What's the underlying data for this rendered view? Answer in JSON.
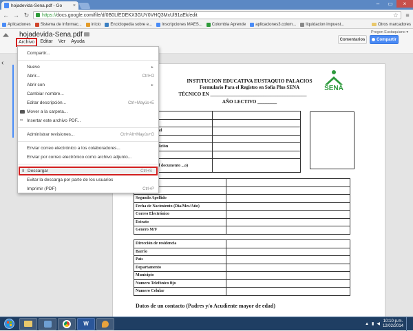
{
  "browser": {
    "tab_title": "hojadevida-Sena.pdf - Go",
    "url_scheme": "https://",
    "url_rest": "docs.google.com/file/d/0B0LfEDEKX3GUY0VHQ3MxUl91aEk/edit",
    "bookmarks": [
      {
        "label": "Aplicaciones",
        "color": "#4a8cf7"
      },
      {
        "label": "Sistema de Informac...",
        "color": "#d0452b"
      },
      {
        "label": "inicio",
        "color": "#e39b29"
      },
      {
        "label": "Enciclopedia sobre e...",
        "color": "#3a7fc2"
      },
      {
        "label": "Inscripciones MAES...",
        "color": "#4a8cf7"
      },
      {
        "label": "Colombia Aprende",
        "color": "#2d9a39"
      },
      {
        "label": "aplicaciones3.colom...",
        "color": "#4a8cf7"
      },
      {
        "label": "liquidacion impuest...",
        "color": "#888888"
      }
    ],
    "other_bookmarks": "Otros marcadores"
  },
  "viewer": {
    "doc_title": "hojadevida-Sena.pdf",
    "menu": {
      "archivo": "Archivo",
      "editar": "Editar",
      "ver": "Ver",
      "ayuda": "Ayuda"
    },
    "user": "Pregon Eustaquiano",
    "comments_btn": "Comentarios",
    "share_btn": "Compartir"
  },
  "archivo_menu": {
    "share": "Compartir...",
    "nuevo": "Nuevo",
    "abrir": "Abrir...",
    "abrir_sc": "Ctrl+O",
    "abrir_con": "Abrir con",
    "cambiar_nombre": "Cambiar nombre...",
    "editar_desc": "Editar descripción...",
    "editar_desc_sc": "Ctrl+Mayús+E",
    "mover": "Mover a la carpeta...",
    "insertar": "Insertar este archivo PDF...",
    "revisiones": "Administrar revisiones...",
    "revisiones_sc": "Ctrl+Alt+Mayús+G",
    "correo_colab": "Enviar correo electrónico a los colaboradores...",
    "correo_adjunto": "Enviar por correo electrónico como archivo adjunto...",
    "descargar": "Descargar",
    "descargar_sc": "Ctrl+S",
    "evitar": "Evitar la descarga por parte de los usuarios",
    "imprimir": "Imprimir (PDF)",
    "imprimir_sc": "Ctrl+P"
  },
  "document": {
    "school": "INSTITUCION EDUCATIVA EUSTAQUIO PALACIOS",
    "form_title": "Formulario Para el Registro en Sofía Plus SENA",
    "tecnico": "TÉCNICO EN ________________________________________",
    "lectivo": "AÑO LECTIVO ________",
    "sena": "SENA",
    "table1": [
      "",
      "...ntificación",
      "... de Identidad",
      "...edición",
      "...to de Expedición",
      "",
      "...pedición del documento ...o)"
    ],
    "table2": [
      "",
      "...llido",
      "Segundo Apellido",
      "Fecha de Nacimiento (Dia/Mes/Año)",
      "Correo Electrónico",
      "Estrato",
      "Genero M/F"
    ],
    "table3": [
      "Dirección de residencia",
      "Barrio",
      "Pais",
      "Departamento",
      "Municipio",
      "Numero Telefónico fijo",
      "Numero Celular"
    ],
    "contact_title": "Datos de un contacto (Padres y/o Acudiente mayor de edad)"
  },
  "taskbar": {
    "word_letter": "W",
    "time": "10:10 p.m.",
    "date": "12/02/2014"
  }
}
